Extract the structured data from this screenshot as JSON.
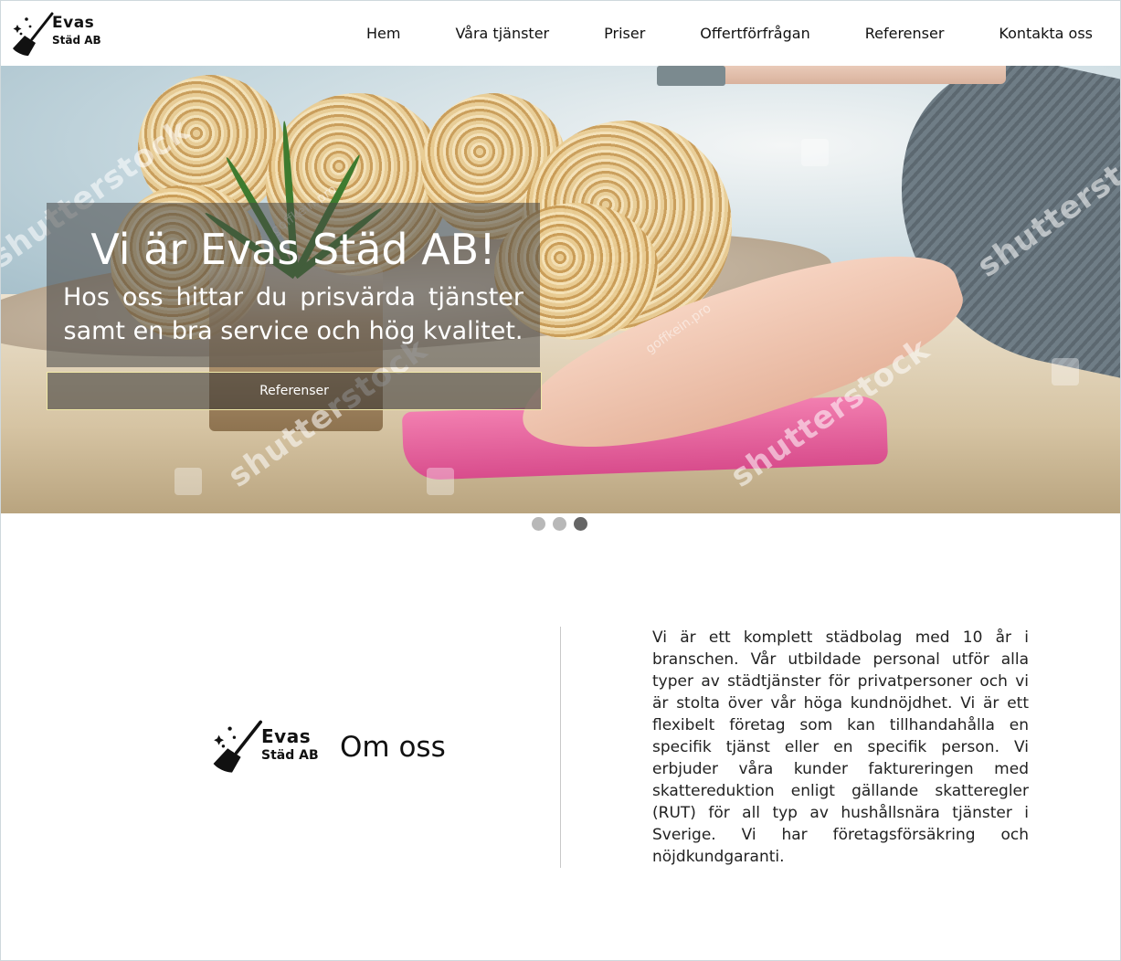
{
  "brand": {
    "name_line1": "Evas",
    "name_line2": "Städ AB"
  },
  "nav": {
    "items": [
      {
        "label": "Hem"
      },
      {
        "label": "Våra tjänster"
      },
      {
        "label": "Priser"
      },
      {
        "label": "Offertförfrågan"
      },
      {
        "label": "Referenser"
      },
      {
        "label": "Kontakta oss"
      }
    ]
  },
  "hero": {
    "title": "Vi är Evas Städ AB!",
    "subtitle": "Hos oss hittar du prisvärda tjänster samt en bra service och hög kvalitet.",
    "button_label": "Referenser",
    "watermarks": [
      "shutterstock",
      "goffkein.pro"
    ],
    "slides": {
      "count": 3,
      "active": 3
    }
  },
  "about": {
    "title": "Om oss",
    "text": "Vi är ett komplett städbolag med 10 år i branschen. Vår utbildade personal utför alla typer av städtjänster för privatpersoner och vi är stolta över vår höga kundnöjdhet. Vi är ett flexibelt företag som kan tillhandahålla en specifik tjänst eller en specifik person. Vi erbjuder våra kunder faktureringen med skattereduktion enligt gällande skatteregler (RUT) för all typ av hushållsnära tjänster i Sverige. Vi har företagsförsäkring och nöjdkundgaranti."
  },
  "colors": {
    "accent_border": "#f1e9a8",
    "dot_active": "#666666",
    "dot_inactive": "#b8b8b8"
  },
  "icons": {
    "logo": "broom-sparkle-icon"
  }
}
